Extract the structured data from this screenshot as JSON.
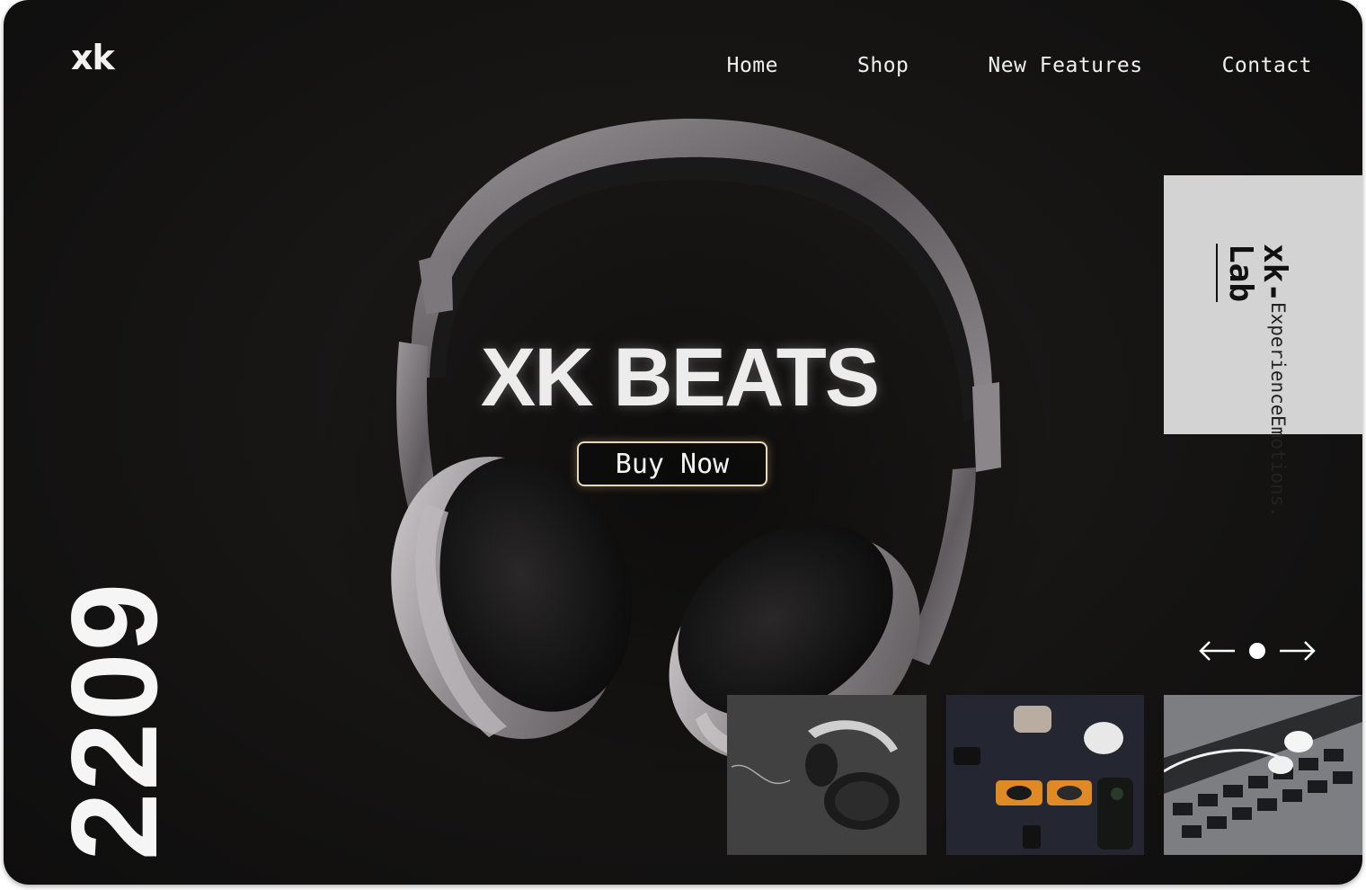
{
  "logo": {
    "text": "xk"
  },
  "nav": {
    "items": [
      "Home",
      "Shop",
      "New Features",
      "Contact"
    ]
  },
  "hero": {
    "title": "XK BEATS",
    "cta_label": "Buy Now"
  },
  "card": {
    "title": "xk-Lab",
    "tagline_1": "Experience",
    "tagline_2": "Emotions."
  },
  "date_label": "2209",
  "slider": {
    "prev_icon": "arrow-left-icon",
    "next_icon": "arrow-right-icon",
    "active_index": 0
  },
  "gallery": [
    "headphones-on-wood-photo",
    "earbud-cases-flatlay-photo",
    "earphones-on-laptop-photo"
  ],
  "colors": {
    "background": "#151413",
    "accent": "#e8d8b8",
    "card": "#d3d3d3",
    "text": "#f2f2f2"
  }
}
